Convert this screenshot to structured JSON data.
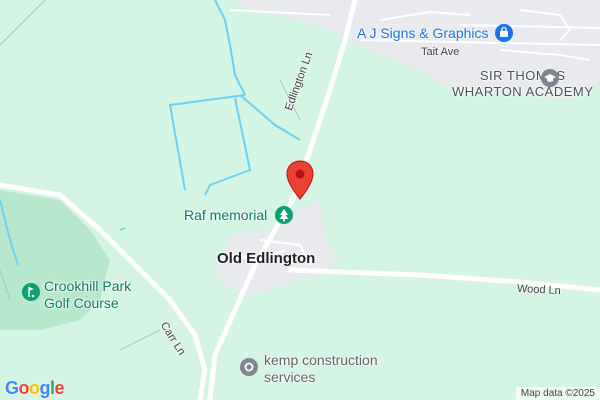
{
  "map": {
    "place_name": "Old Edlington",
    "roads": {
      "edlington_ln": "Edlington Ln",
      "tait_ave": "Tait Ave",
      "wood_ln": "Wood Ln",
      "carr_ln": "Carr Ln"
    },
    "pois": {
      "shop": {
        "name": "A J Signs & Graphics",
        "icon": "shopping-bag-icon",
        "color": "#1a73e8"
      },
      "school": {
        "line1": "SIR THOMAS",
        "line2": "WHARTON ACADEMY",
        "icon": "graduation-cap-icon"
      },
      "memorial": {
        "name": "Raf memorial",
        "icon": "tree-icon",
        "color": "#0d9e74"
      },
      "golf": {
        "line1": "Crookhill Park",
        "line2": "Golf Course",
        "icon": "golf-icon",
        "color": "#0d9e74"
      },
      "construction": {
        "line1": "kemp construction",
        "line2": "services",
        "icon": "location-dot-icon",
        "color": "#7c8791"
      }
    },
    "marker": {
      "icon": "red-map-pin-icon",
      "color": "#ea4335"
    },
    "colors": {
      "land": "#d4f5e4",
      "built_up": "#e8eaed",
      "water": "#6cd0f5",
      "road": "#ffffff",
      "forest": "#b8e8cb"
    },
    "google_logo": [
      "G",
      "o",
      "o",
      "g",
      "l",
      "e"
    ],
    "attribution": "Map data ©2025"
  }
}
